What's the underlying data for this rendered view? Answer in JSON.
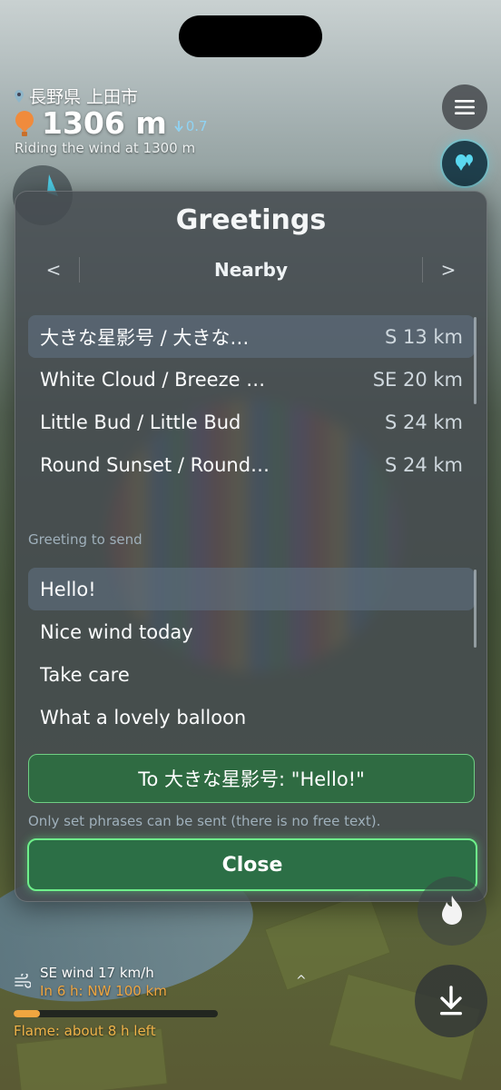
{
  "hud": {
    "location": "長野県 上田市",
    "altitude": "1306 m",
    "vario": "0.7",
    "status": "Riding the wind at 1300 m"
  },
  "dialog": {
    "title": "Greetings",
    "nav": {
      "prev": "<",
      "title": "Nearby",
      "next": ">"
    },
    "nearby": [
      {
        "name": "大きな星影号 / 大きな…",
        "dist": "S 13 km",
        "selected": true
      },
      {
        "name": "White Cloud / Breeze …",
        "dist": "SE 20 km",
        "selected": false
      },
      {
        "name": "Little Bud / Little Bud",
        "dist": "S 24 km",
        "selected": false
      },
      {
        "name": "Round Sunset / Round…",
        "dist": "S 24 km",
        "selected": false
      }
    ],
    "greeting_label": "Greeting to send",
    "phrases": [
      {
        "text": "Hello!",
        "selected": true
      },
      {
        "text": "Nice wind today",
        "selected": false
      },
      {
        "text": "Take care",
        "selected": false
      },
      {
        "text": "What a lovely balloon",
        "selected": false
      }
    ],
    "send_label": "To 大きな星影号: \"Hello!\"",
    "note": "Only set phrases can be sent (there is no free text).",
    "close_label": "Close"
  },
  "wind": {
    "current": "SE wind 17 km/h",
    "forecast": "In 6 h: NW 100 km",
    "flame_left": "Flame: about 8 h left",
    "flame_fraction": 0.13
  },
  "colors": {
    "accent_green": "#2f6b42",
    "highlight_green": "#6ef08a",
    "warning_orange": "#f0a640",
    "vario_blue": "#8fd3f3"
  },
  "icons": [
    "pin-icon",
    "balloon-icon",
    "arrow-down-icon",
    "menu-icon",
    "balloons-icon",
    "wind-icon",
    "flame-icon",
    "descend-icon",
    "chevron-up-icon"
  ]
}
